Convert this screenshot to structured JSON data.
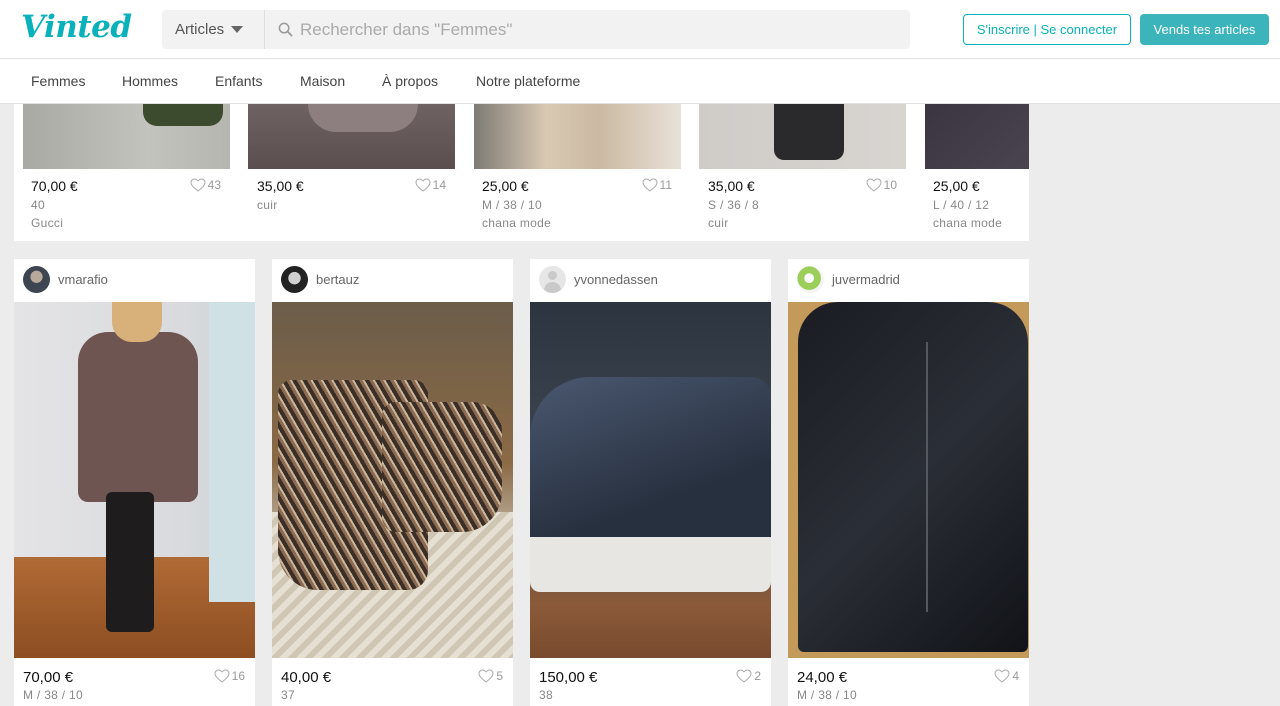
{
  "header": {
    "logo": "Vinted",
    "category_select": "Articles",
    "search_placeholder": "Rechercher dans \"Femmes\"",
    "login_label": "S'inscrire | Se connecter",
    "sell_label": "Vends tes articles",
    "accent_color": "#09b1ba"
  },
  "nav": [
    "Femmes",
    "Hommes",
    "Enfants",
    "Maison",
    "À propos",
    "Notre plateforme"
  ],
  "top_items": [
    {
      "price": "70,00 €",
      "favs": "43",
      "size": "40",
      "brand": "Gucci"
    },
    {
      "price": "35,00 €",
      "favs": "14",
      "size": "cuir",
      "brand": ""
    },
    {
      "price": "25,00 €",
      "favs": "11",
      "size": "M / 38 / 10",
      "brand": "chana mode"
    },
    {
      "price": "35,00 €",
      "favs": "10",
      "size": "S / 36 / 8",
      "brand": "cuir"
    },
    {
      "price": "25,00 €",
      "favs": "",
      "size": "L / 40 / 12",
      "brand": "chana mode"
    }
  ],
  "items": [
    {
      "user": "vmarafio",
      "price": "70,00 €",
      "favs": "16",
      "size": "M / 38 / 10"
    },
    {
      "user": "bertauz",
      "price": "40,00 €",
      "favs": "5",
      "size": "37"
    },
    {
      "user": "yvonnedassen",
      "price": "150,00 €",
      "favs": "2",
      "size": "38"
    },
    {
      "user": "juvermadrid",
      "price": "24,00 €",
      "favs": "4",
      "size": "M / 38 / 10"
    }
  ]
}
